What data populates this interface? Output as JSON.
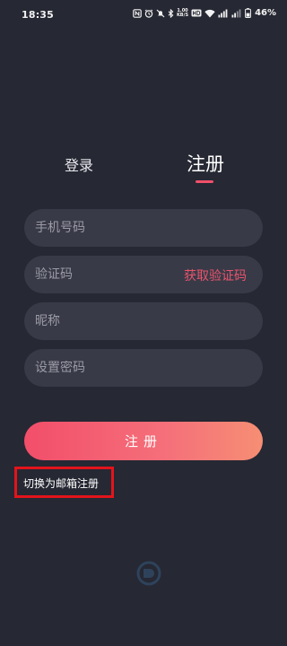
{
  "status_bar": {
    "time": "18:35",
    "speed_value": "1.00",
    "speed_unit": "KB/S",
    "battery_percent": "46%"
  },
  "tabs": {
    "login_label": "登录",
    "register_label": "注册"
  },
  "form": {
    "phone_placeholder": "手机号码",
    "code_placeholder": "验证码",
    "get_code_label": "获取验证码",
    "nickname_placeholder": "昵称",
    "password_placeholder": "设置密码",
    "register_button_label": "注册",
    "switch_email_label": "切换为邮箱注册"
  },
  "colors": {
    "background": "#262833",
    "field_background": "#393a47",
    "accent": "#f0506a",
    "highlight_box": "#e3141b"
  }
}
